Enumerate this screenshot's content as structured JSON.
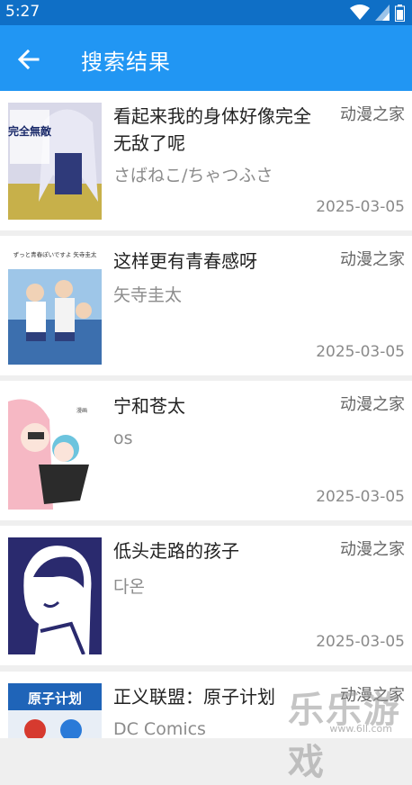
{
  "status_bar": {
    "time": "5:27"
  },
  "header": {
    "title": "搜索结果",
    "back_icon": "arrow-left-icon"
  },
  "results": [
    {
      "name": "看起来我的身体好像完全无敌了呢",
      "author": "さばねこ/ちゃつふさ",
      "source": "动漫之家",
      "date": "2025-03-05",
      "cover_title": "完全無敵"
    },
    {
      "name": "这样更有青春感呀",
      "author": "矢寺圭太",
      "source": "动漫之家",
      "date": "2025-03-05",
      "cover_title": "ずっと青春ぽいですよ 矢寺圭太"
    },
    {
      "name": "宁和苍太",
      "author": "os",
      "source": "动漫之家",
      "date": "2025-03-05",
      "cover_title": ""
    },
    {
      "name": "低头走路的孩子",
      "author": "다온",
      "source": "动漫之家",
      "date": "2025-03-05",
      "cover_title": ""
    },
    {
      "name": "正义联盟：原子计划",
      "author": "DC Comics",
      "source": "动漫之家",
      "date": "",
      "cover_title": "原子计划"
    }
  ],
  "watermark": {
    "text": "乐乐游戏",
    "url": "www.6ll.com"
  },
  "colors": {
    "status_bar": "#0f6fc6",
    "app_bar": "#2196f3",
    "background": "#efefef"
  }
}
